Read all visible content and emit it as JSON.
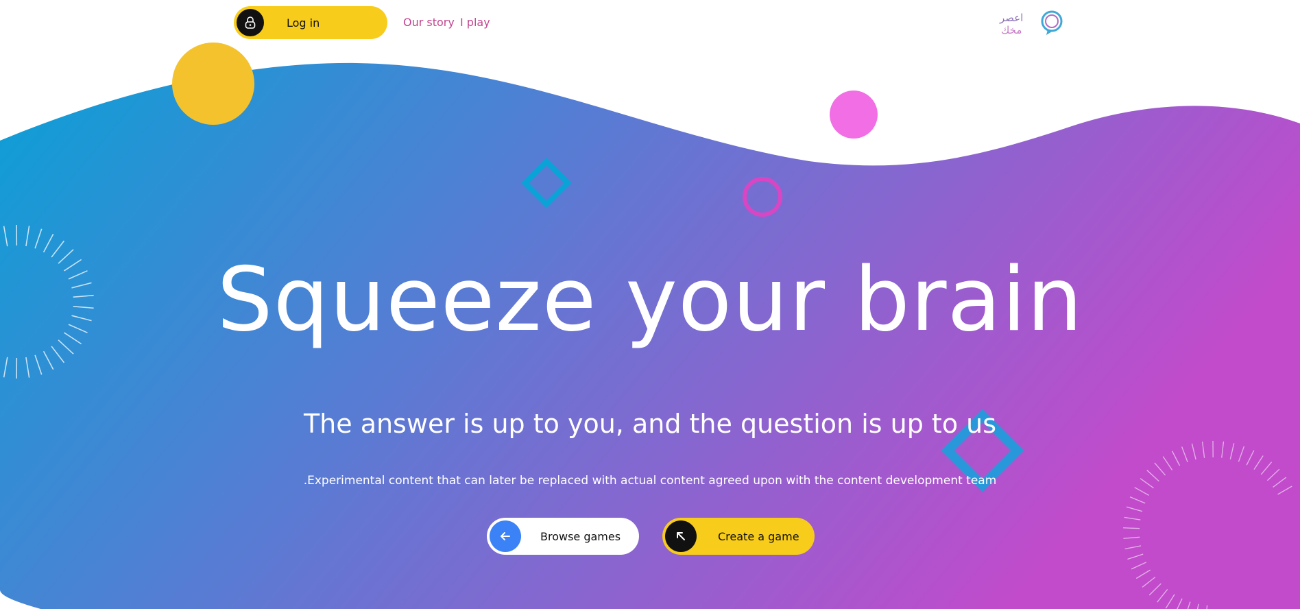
{
  "header": {
    "login_label": "Log in",
    "nav": [
      {
        "label": "Our story"
      },
      {
        "label": "I play"
      }
    ],
    "logo_text_line1": "اعصر",
    "logo_text_line2": "مخك"
  },
  "hero": {
    "title": "Squeeze your brain",
    "subtitle": "The answer is up to you, and the question is up to us",
    "description": ".Experimental content that can later be replaced with actual content agreed upon with the content development team"
  },
  "actions": {
    "browse_label": "Browse games",
    "create_label": "Create a game"
  },
  "colors": {
    "gradient_start": "#0aa0d6",
    "gradient_mid": "#5a7bd3",
    "gradient_end": "#c14bcb",
    "accent_yellow": "#f8cc1b",
    "accent_pink": "#f16ee4",
    "accent_blue": "#3b82f6",
    "nav_link": "#c2448f"
  },
  "icons": {
    "login": "lock-icon",
    "browse": "arrow-left-icon",
    "create": "arrow-up-left-icon"
  }
}
